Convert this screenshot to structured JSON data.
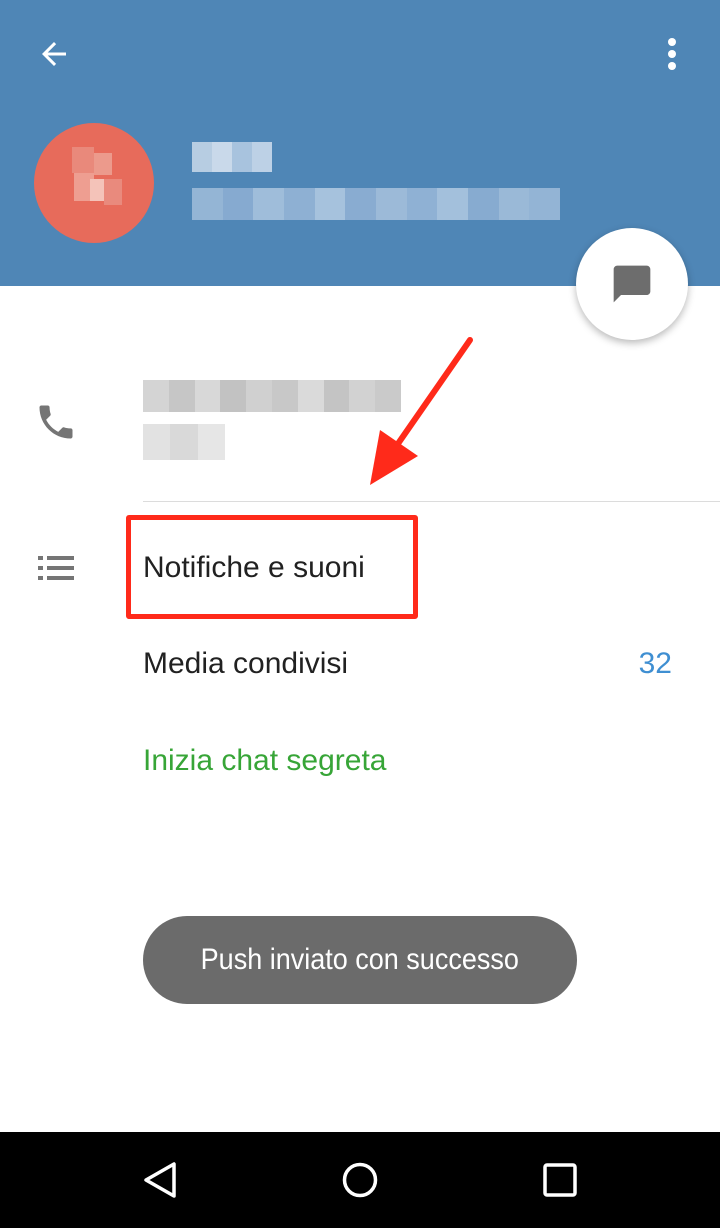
{
  "header": {
    "background_color": "#4f86b6",
    "back_icon": "arrow-left-icon",
    "menu_icon": "more-vertical-icon",
    "avatar_color": "#e76b5b"
  },
  "fab": {
    "icon": "chat-bubble-icon"
  },
  "contact": {
    "phone_icon": "phone-icon"
  },
  "menu": {
    "icon": "list-icon",
    "items": [
      {
        "label": "Notifiche e suoni"
      },
      {
        "label": "Media condivisi",
        "count": "32"
      },
      {
        "label": "Inizia chat segreta",
        "color": "#37a537"
      }
    ]
  },
  "annotation": {
    "color": "#ff2a1a"
  },
  "toast": {
    "text": "Push inviato con successo"
  },
  "navbar": {
    "back_icon": "triangle-back-icon",
    "home_icon": "circle-home-icon",
    "recent_icon": "square-recent-icon"
  }
}
